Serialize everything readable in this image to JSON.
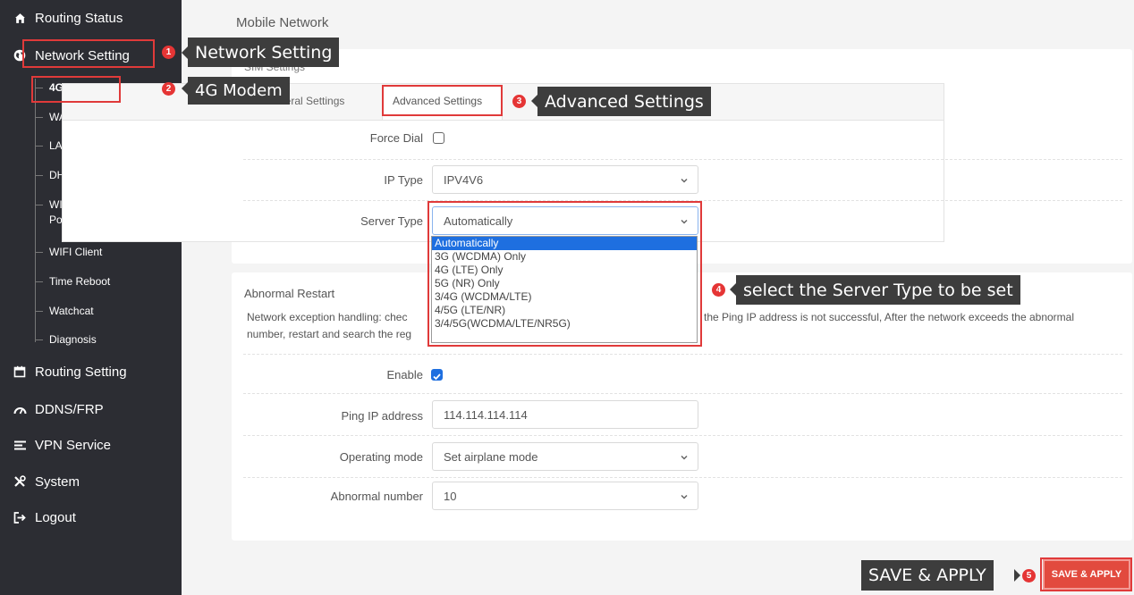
{
  "sidebar": {
    "routing_status": "Routing Status",
    "network_setting": "Network Setting",
    "sub_items": [
      "4G Modem",
      "WAN Setting",
      "LAN Setting",
      "DHCP Setting",
      "WIFI Access",
      "Point",
      "WIFI Client",
      "Time Reboot",
      "Watchcat",
      "Diagnosis"
    ],
    "routing_setting": "Routing Setting",
    "ddns": "DDNS/FRP",
    "vpn": "VPN Service",
    "system": "System",
    "logout": "Logout"
  },
  "main": {
    "title": "Mobile Network",
    "sim_settings": "SIM Settings",
    "tabs": {
      "general": "General Settings",
      "advanced": "Advanced Settings"
    },
    "force_dial_label": "Force Dial",
    "ip_type_label": "IP Type",
    "ip_type_value": "IPV4V6",
    "server_type_label": "Server Type",
    "server_type_value": "Automatically",
    "server_type_options": [
      "Automatically",
      "3G (WCDMA) Only",
      "4G (LTE) Only",
      "5G (NR) Only",
      "3/4G (WCDMA/LTE)",
      "4/5G (LTE/NR)",
      "3/4/5G(WCDMA/LTE/NR5G)"
    ],
    "abnormal_restart": "Abnormal Restart",
    "desc_left_1": "Network exception handling: chec",
    "desc_right_1": "the Ping IP address is not successful, After the network exceeds the abnormal",
    "desc_left_2": "number, restart and search the reg",
    "enable_label": "Enable",
    "enable_checked": true,
    "ping_label": "Ping IP address",
    "ping_value": "114.114.114.114",
    "operating_mode_label": "Operating mode",
    "operating_mode_value": "Set airplane mode",
    "abnormal_number_label": "Abnormal number",
    "abnormal_number_value": "10",
    "save_apply": "SAVE & APPLY"
  },
  "annotations": {
    "c1": "Network Setting",
    "c2": "4G Modem",
    "c3": "Advanced Settings",
    "c4": "select the Server Type to be set",
    "c5": "SAVE & APPLY",
    "n1": "1",
    "n2": "2",
    "n3": "3",
    "n4": "4",
    "n5": "5"
  },
  "colors": {
    "accent_red": "#e24a3e",
    "select_blue": "#1e6fe0",
    "sidebar_bg": "#2c2d33"
  }
}
